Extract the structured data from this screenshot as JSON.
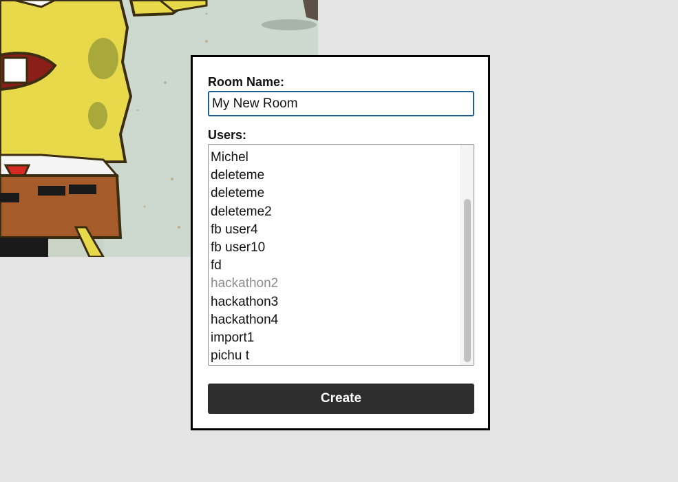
{
  "background_image": {
    "subject": "cartoon-character-image"
  },
  "dialog": {
    "room_name_label": "Room Name:",
    "room_name_value": "My New Room",
    "users_label": "Users:",
    "users": [
      {
        "name": "Michel",
        "disabled": false
      },
      {
        "name": "deleteme",
        "disabled": false
      },
      {
        "name": "deleteme",
        "disabled": false
      },
      {
        "name": "deleteme2",
        "disabled": false
      },
      {
        "name": "fb user4",
        "disabled": false
      },
      {
        "name": "fb user10",
        "disabled": false
      },
      {
        "name": "fd",
        "disabled": false
      },
      {
        "name": "hackathon2",
        "disabled": true
      },
      {
        "name": "hackathon3",
        "disabled": false
      },
      {
        "name": "hackathon4",
        "disabled": false
      },
      {
        "name": "import1",
        "disabled": false
      },
      {
        "name": "pichu t",
        "disabled": false
      }
    ],
    "create_label": "Create"
  },
  "colors": {
    "page_background": "#e4e4e4",
    "button_background": "#2d2d2d",
    "input_focus_border": "#1d5e8f",
    "disabled_text": "#8d8d8d"
  }
}
